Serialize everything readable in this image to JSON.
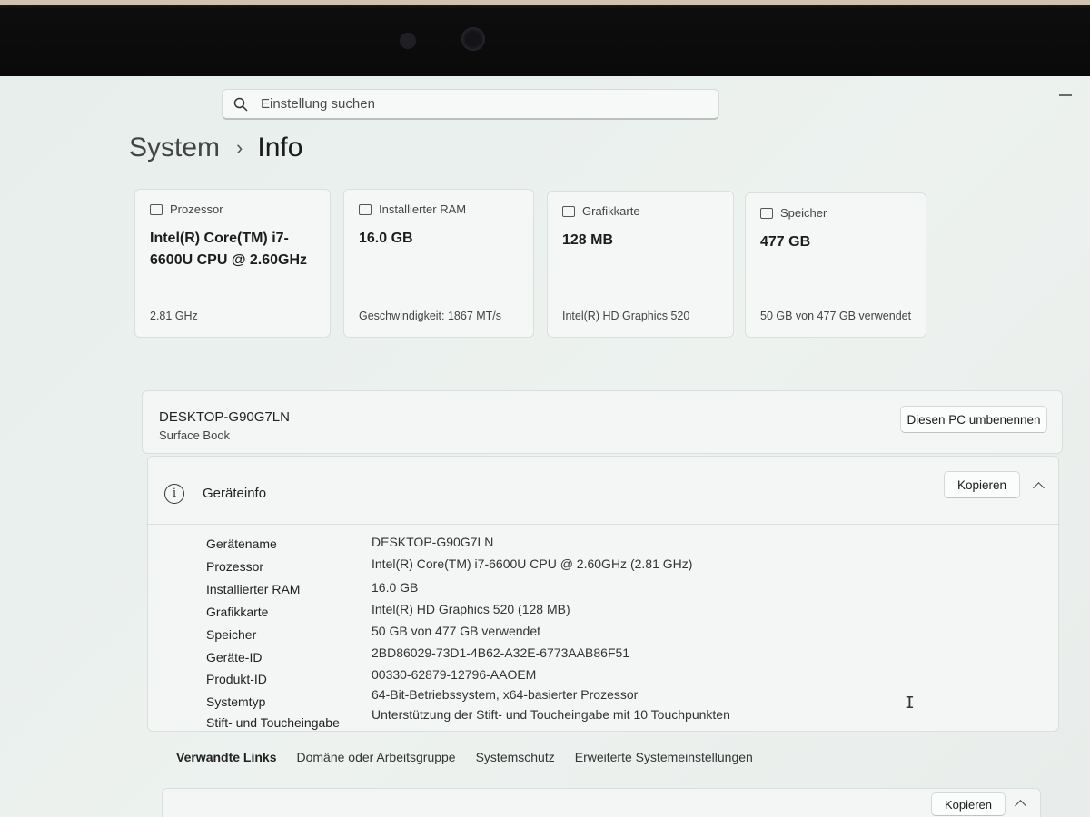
{
  "search": {
    "placeholder": "Einstellung suchen"
  },
  "breadcrumb": {
    "parent": "System",
    "separator": "›",
    "current": "Info"
  },
  "cards": [
    {
      "label": "Prozessor",
      "icon": "processor-icon",
      "value": "Intel(R) Core(TM) i7-6600U CPU @ 2.60GHz",
      "sub": "2.81 GHz"
    },
    {
      "label": "Installierter RAM",
      "icon": "ram-icon",
      "value": "16.0 GB",
      "sub": "Geschwindigkeit: 1867 MT/s"
    },
    {
      "label": "Grafikkarte",
      "icon": "graphics-card-icon",
      "value": "128 MB",
      "sub": "Intel(R) HD Graphics 520"
    },
    {
      "label": "Speicher",
      "icon": "storage-icon",
      "value": "477 GB",
      "sub": "50 GB von 477 GB verwendet"
    }
  ],
  "device": {
    "name": "DESKTOP-G90G7LN",
    "model": "Surface Book",
    "rename_label": "Diesen PC umbenennen"
  },
  "device_info": {
    "title": "Geräteinfo",
    "copy_label": "Kopieren",
    "rows": [
      {
        "label": "Gerätename",
        "value": "DESKTOP-G90G7LN"
      },
      {
        "label": "Prozessor",
        "value": "Intel(R) Core(TM) i7-6600U CPU @ 2.60GHz (2.81 GHz)"
      },
      {
        "label": "Installierter RAM",
        "value": "16.0 GB"
      },
      {
        "label": "Grafikkarte",
        "value": "Intel(R) HD Graphics 520 (128 MB)"
      },
      {
        "label": "Speicher",
        "value": "50 GB von 477 GB verwendet"
      },
      {
        "label": "Geräte-ID",
        "value": "2BD86029-73D1-4B62-A32E-6773AAB86F51"
      },
      {
        "label": "Produkt-ID",
        "value": "00330-62879-12796-AAOEM"
      },
      {
        "label": "Systemtyp",
        "value": "64-Bit-Betriebssystem, x64-basierter Prozessor"
      },
      {
        "label": "Stift- und Toucheingabe",
        "value": "Unterstützung der Stift- und Toucheingabe mit 10 Touchpunkten"
      }
    ]
  },
  "related_links": {
    "title": "Verwandte Links",
    "items": [
      "Domäne oder Arbeitsgruppe",
      "Systemschutz",
      "Erweiterte Systemeinstellungen"
    ]
  },
  "next_panel": {
    "copy_label": "Kopieren"
  }
}
